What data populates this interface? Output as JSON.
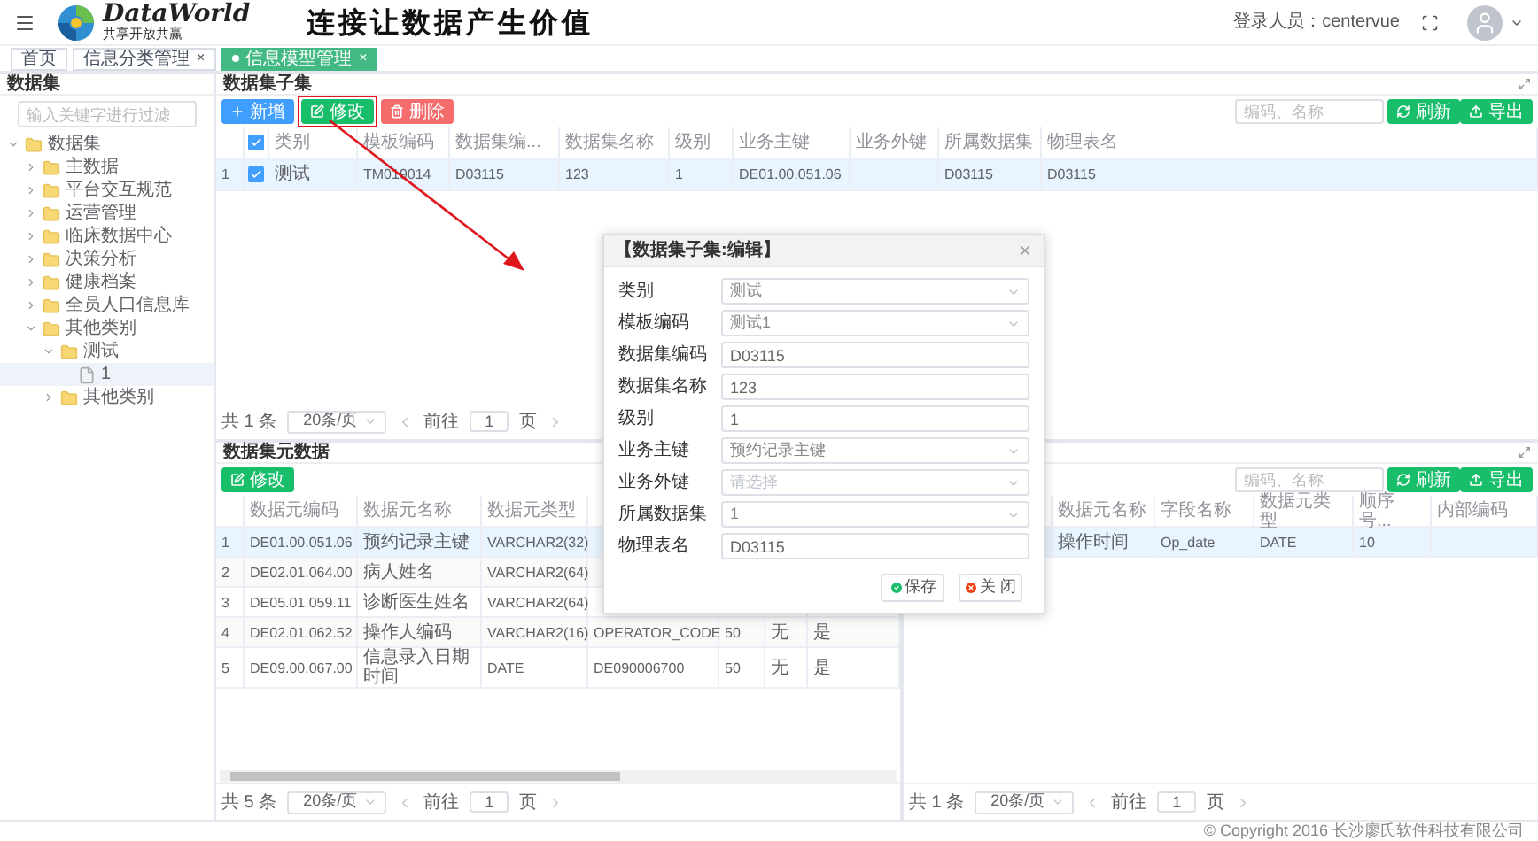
{
  "header": {
    "logo_name": "DataWorld",
    "logo_tagline": "共享开放共赢",
    "slogan": "连接让数据产生价值",
    "user_label": "登录人员：centervue"
  },
  "tabs": [
    {
      "label": "首页",
      "selected": false
    },
    {
      "label": "信息分类管理",
      "close": "×",
      "selected": false
    },
    {
      "label": "信息模型管理",
      "close": "×",
      "selected": true
    }
  ],
  "sidebar": {
    "title": "数据集",
    "search_placeholder": "输入关键字进行过滤",
    "tree": [
      {
        "label": "数据集",
        "kind": "folder",
        "expanded": true,
        "selected": false,
        "children": [
          {
            "label": "主数据",
            "kind": "folder",
            "expanded": false,
            "selected": false
          },
          {
            "label": "平台交互规范",
            "kind": "folder",
            "expanded": false,
            "selected": false
          },
          {
            "label": "运营管理",
            "kind": "folder",
            "expanded": false,
            "selected": false
          },
          {
            "label": "临床数据中心",
            "kind": "folder",
            "expanded": false,
            "selected": false
          },
          {
            "label": "决策分析",
            "kind": "folder",
            "expanded": false,
            "selected": false
          },
          {
            "label": "健康档案",
            "kind": "folder",
            "expanded": false,
            "selected": false
          },
          {
            "label": "全员人口信息库",
            "kind": "folder",
            "expanded": false,
            "selected": false
          },
          {
            "label": "其他类别",
            "kind": "folder",
            "expanded": true,
            "selected": false,
            "children": [
              {
                "label": "测试",
                "kind": "folder",
                "expanded": true,
                "selected": false,
                "children": [
                  {
                    "label": "1",
                    "kind": "file",
                    "selected": true
                  }
                ]
              },
              {
                "label": "其他类别",
                "kind": "folder",
                "expanded": false,
                "selected": false
              }
            ]
          }
        ]
      }
    ]
  },
  "subset_panel": {
    "title": "数据集子集",
    "buttons": [
      {
        "kind": "add",
        "label": "新增",
        "highlighted": false
      },
      {
        "kind": "edit",
        "label": "修改",
        "highlighted": true
      },
      {
        "kind": "delete",
        "label": "删除",
        "highlighted": false
      }
    ],
    "search_placeholder": "编码、名称",
    "actions": [
      {
        "kind": "refresh",
        "label": "刷新"
      },
      {
        "kind": "export",
        "label": "导出"
      }
    ],
    "table": {
      "header_checked": true,
      "columns": [
        "类别",
        "模板编码",
        "数据集编...",
        "数据集名称",
        "级别",
        "业务主键",
        "业务外键",
        "所属数据集",
        "物理表名"
      ],
      "rows": [
        {
          "index": "1",
          "checked": true,
          "selected": true,
          "category": "测试",
          "template_code": "TM019014",
          "dataset_code": "D03115",
          "dataset_name": "123",
          "level": "1",
          "business_key": "DE01.00.051.06",
          "owner_dataset": "D03115",
          "table_name": "D03115"
        }
      ]
    },
    "pagination": {
      "total": "共 1 条",
      "page_size": "20条/页",
      "goto": "前往",
      "page": "1",
      "page_unit": "页"
    }
  },
  "element_panel": {
    "title": "数据集元数据",
    "buttons": [
      {
        "kind": "edit",
        "label": "修改",
        "highlighted": false
      }
    ],
    "left_table": {
      "columns": [
        "数据元编码",
        "数据元名称",
        "数据元类型"
      ],
      "rows": [
        {
          "index": "1",
          "selected": true,
          "cells": [
            "DE01.00.051.06",
            "预约记录主键",
            "VARCHAR2(32)"
          ]
        },
        {
          "index": "2",
          "selected": false,
          "cells": [
            "DE02.01.064.00",
            "病人姓名",
            "VARCHAR2(64)"
          ]
        },
        {
          "index": "3",
          "selected": false,
          "cells": [
            "DE05.01.059.11",
            "诊断医生姓名",
            "VARCHAR2(64)"
          ]
        },
        {
          "index": "4",
          "selected": false,
          "cells": [
            "DE02.01.062.52",
            "操作人编码",
            "VARCHAR2(16)",
            "OPERATOR_CODE",
            "50",
            "无",
            "是"
          ]
        },
        {
          "index": "5",
          "selected": false,
          "cells": [
            "DE09.00.067.00",
            "信息录入日期时间",
            "DATE",
            "DE090006700",
            "50",
            "无",
            "是"
          ]
        }
      ]
    },
    "left_pagination": {
      "total": "共 5 条",
      "page_size": "20条/页",
      "goto": "前往",
      "page": "1",
      "page_unit": "页"
    },
    "search_placeholder": "编码、名称",
    "actions": [
      {
        "kind": "refresh",
        "label": "刷新"
      },
      {
        "kind": "export",
        "label": "导出"
      }
    ],
    "right_table": {
      "columns": [
        "数据元名称",
        "字段名称",
        "数据元类型",
        "顺序号...",
        "内部编码"
      ],
      "rows": [
        {
          "selected": true,
          "cells": [
            "操作时间",
            "Op_date",
            "DATE",
            "10"
          ]
        }
      ]
    },
    "right_pagination": {
      "total": "共 1 条",
      "page_size": "20条/页",
      "goto": "前往",
      "page": "1",
      "page_unit": "页"
    }
  },
  "dialog": {
    "title": "【数据集子集:编辑】",
    "fields": [
      {
        "label": "类别",
        "kind": "select",
        "value": "测试"
      },
      {
        "label": "模板编码",
        "kind": "select",
        "value": "测试1"
      },
      {
        "label": "数据集编码",
        "kind": "input",
        "value": "D03115"
      },
      {
        "label": "数据集名称",
        "kind": "input",
        "value": "123"
      },
      {
        "label": "级别",
        "kind": "input",
        "value": "1"
      },
      {
        "label": "业务主键",
        "kind": "select",
        "value": "预约记录主键"
      },
      {
        "label": "业务外键",
        "kind": "select",
        "placeholder": "请选择"
      },
      {
        "label": "所属数据集",
        "kind": "select",
        "value": "1"
      },
      {
        "label": "物理表名",
        "kind": "input",
        "value": "D03115"
      }
    ],
    "buttons": [
      {
        "kind": "save",
        "label": "保存"
      },
      {
        "kind": "close",
        "label": "关 闭"
      }
    ]
  },
  "footer": "© Copyright 2016 长沙廖氏软件科技有限公司"
}
